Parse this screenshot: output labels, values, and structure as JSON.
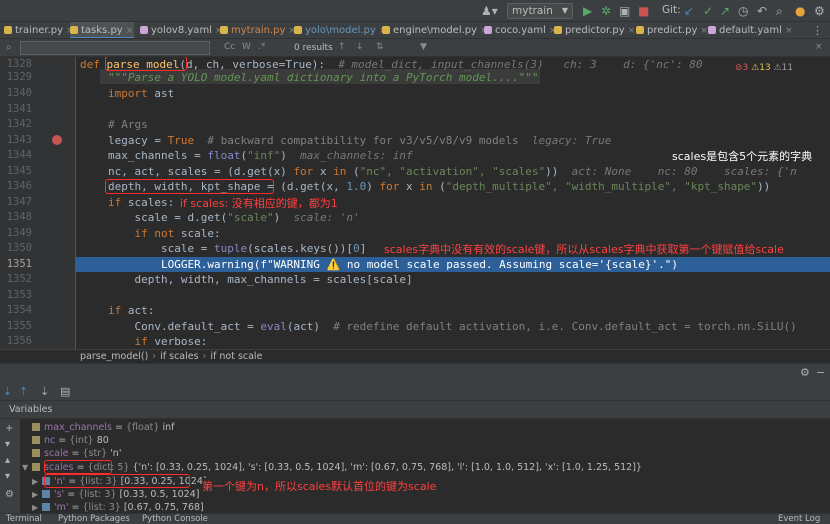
{
  "toolbar": {
    "run_config": "mytrain",
    "git_label": "Git:"
  },
  "tabs": [
    {
      "label": "trainer.py",
      "style": "normal"
    },
    {
      "label": "tasks.py",
      "style": "normal",
      "active": true
    },
    {
      "label": "yolov8.yaml",
      "style": "normal"
    },
    {
      "label": "mytrain.py",
      "style": "mod"
    },
    {
      "label": "yolo\\model.py",
      "style": "blue"
    },
    {
      "label": "engine\\model.py",
      "style": "normal"
    },
    {
      "label": "coco.yaml",
      "style": "normal"
    },
    {
      "label": "predictor.py",
      "style": "normal"
    },
    {
      "label": "predict.py",
      "style": "normal"
    },
    {
      "label": "default.yaml",
      "style": "normal"
    }
  ],
  "search": {
    "value": "",
    "results": "0 results",
    "opt_cc": "Cc",
    "opt_w": "W",
    "opt_regex": ".*"
  },
  "inspections": {
    "errors": "3",
    "warnings": "13",
    "weak": "11"
  },
  "editor": {
    "line_numbers": [
      "1328",
      "1329",
      "1340",
      "1341",
      "1342",
      "1343",
      "1344",
      "1345",
      "1346",
      "1347",
      "1348",
      "1349",
      "1350",
      "1351",
      "1352",
      "1353",
      "1354",
      "1355",
      "1356"
    ],
    "current_line": "1351",
    "lines": {
      "l1328": {
        "kw": "def ",
        "fn": "parse_model",
        "rest": "(d, ch, verbose=True):  ",
        "hint": "# model_dict, input_channels(3)   ch: 3    d: {'nc': 80"
      },
      "l1329": "\"\"\"Parse a YOLO model.yaml dictionary into a PyTorch model....\"\"\"",
      "l1340_kw": "import",
      "l1340_rest": " ast",
      "l1342": "# Args",
      "l1343_a": "legacy = ",
      "l1343_b": "True",
      "l1343_c": "  # backward compatibility for v3/v5/v8/v9 models",
      "l1343_hint": "legacy: True",
      "l1344_a": "max_channels = ",
      "l1344_b": "float",
      "l1344_c": "(",
      "l1344_d": "\"inf\"",
      "l1344_e": ")",
      "l1344_hint": "max_channels: inf",
      "l1345_a": "nc, act, scales = (d.get(x) ",
      "l1345_b": "for",
      "l1345_c": " x ",
      "l1345_d": "in",
      "l1345_e": " (",
      "l1345_f": "\"nc\", \"activation\", \"scales\"",
      "l1345_g": "))",
      "l1345_hint": "act: None    nc: 80    scales: {'n",
      "l1346_a": "depth, width, kpt_shape",
      "l1346_b": " = (d.get(x, ",
      "l1346_c": "1.0",
      "l1346_d": ") ",
      "l1346_e": "for",
      "l1346_f": " x ",
      "l1346_g": "in",
      "l1346_h": " (",
      "l1346_i": "\"depth_multiple\", \"width_multiple\", \"kpt_shape\"",
      "l1346_j": "))",
      "l1347_kw": "if",
      "l1347_rest": " scales:",
      "l1348_a": "    scale = d.get(",
      "l1348_b": "\"scale\"",
      "l1348_c": ")",
      "l1348_hint": "scale: 'n'",
      "l1349_kw": "    if not",
      "l1349_rest": " scale:",
      "l1350_a": "        scale = ",
      "l1350_b": "tuple",
      "l1350_c": "(scales.keys())[",
      "l1350_d": "0",
      "l1350_e": "]",
      "l1351": "        LOGGER.warning(f\"WARNING ⚠️ no model scale passed. Assuming scale='{scale}'.\")",
      "l1352": "    depth, width, max_channels = scales[scale]",
      "l1354_kw": "if",
      "l1354_rest": " act:",
      "l1355_a": "    Conv.default_act = ",
      "l1355_b": "eval",
      "l1355_c": "(act)  ",
      "l1355_d": "# redefine default activation, i.e. Conv.default_act = torch.nn.SiLU()",
      "l1356_kw": "    if",
      "l1356_rest": " verbose:"
    }
  },
  "annotations": {
    "scales_desc": "scales是包含5个元素的字典",
    "no_key": "if scales: 没有相应的键，都为1",
    "first_key": "scales字典中没有有效的scale键，所以从scales字典中获取第一个键赋值给scale",
    "var_note": "第一个键为n，所以scales默认首位的键为scale"
  },
  "breadcrumb": [
    "parse_model()",
    "if scales",
    "if not scale"
  ],
  "debug": {
    "variables_title": "Variables",
    "vars": [
      {
        "name": "max_channels",
        "type": "{float}",
        "value": "inf",
        "indent": 0
      },
      {
        "name": "nc",
        "type": "{int}",
        "value": "80",
        "indent": 0
      },
      {
        "name": "scale",
        "type": "{str}",
        "value": "'n'",
        "indent": 0
      },
      {
        "name": "scales",
        "type": "{dict: 5}",
        "value": "{'n': [0.33, 0.25, 1024], 's': [0.33, 0.5, 1024], 'm': [0.67, 0.75, 768], 'l': [1.0, 1.0, 512], 'x': [1.0, 1.25, 512]}",
        "indent": 0,
        "expanded": true
      },
      {
        "name": "'n'",
        "type": "{list: 3}",
        "value": "[0.33, 0.25, 1024]",
        "indent": 1
      },
      {
        "name": "'s'",
        "type": "{list: 3}",
        "value": "[0.33, 0.5, 1024]",
        "indent": 1
      },
      {
        "name": "'m'",
        "type": "{list: 3}",
        "value": "[0.67, 0.75, 768]",
        "indent": 1
      }
    ]
  },
  "statusbar": {
    "terminal": "Terminal",
    "packages": "Python Packages",
    "console": "Python Console",
    "event_log": "Event Log"
  }
}
